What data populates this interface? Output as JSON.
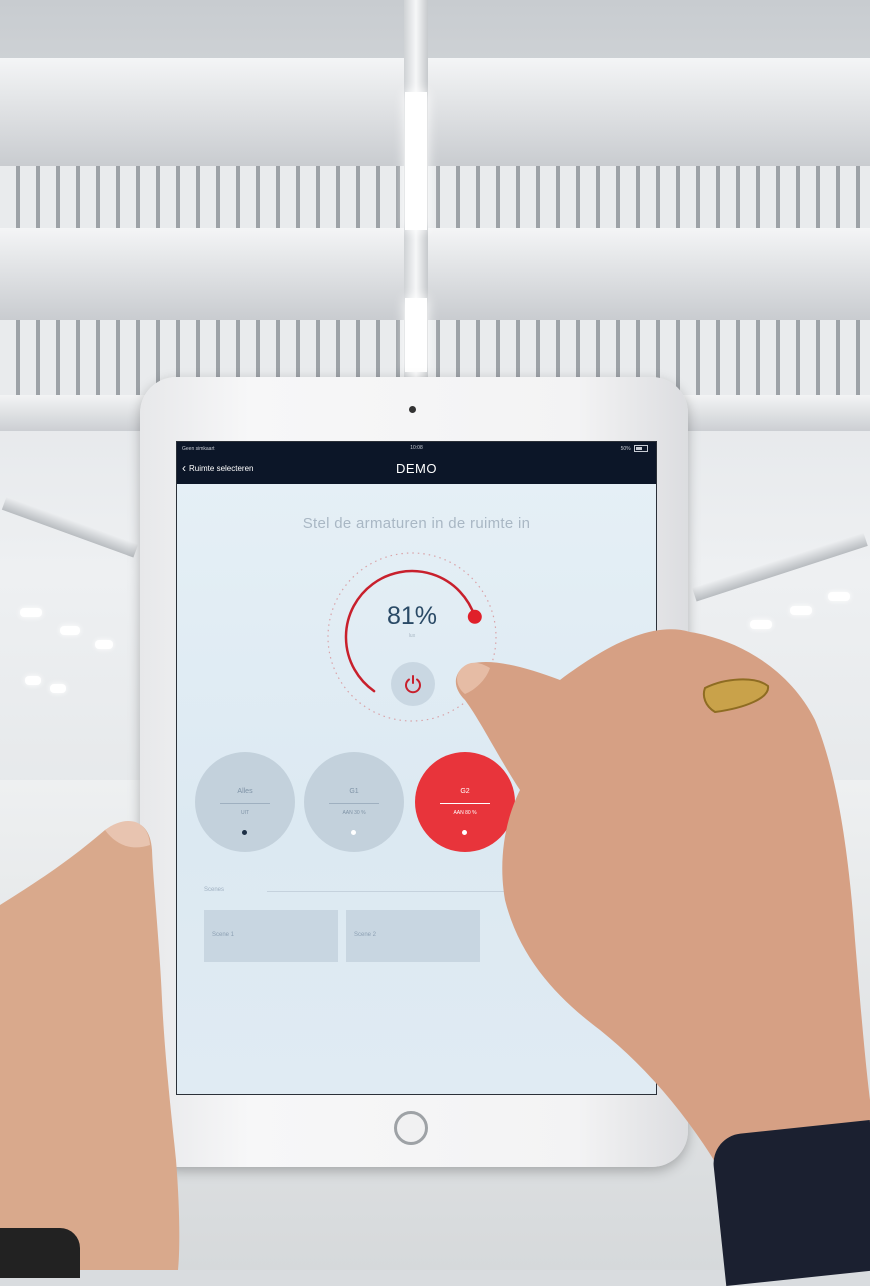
{
  "status_bar": {
    "carrier": "Geen simkaart",
    "time": "10:08",
    "battery": "50%"
  },
  "nav": {
    "back_label": "Ruimte selecteren",
    "title": "DEMO"
  },
  "heading": "Stel de armaturen in de ruimte in",
  "dimmer": {
    "level_label": "81%",
    "level_fraction": 0.81,
    "sub_label": "lux",
    "accent_color": "#c8202c"
  },
  "groups": [
    {
      "name": "Alles",
      "status": "UIT",
      "active": false
    },
    {
      "name": "G1",
      "status": "AAN 30 %",
      "active": false
    },
    {
      "name": "G2",
      "status": "AAN 80 %",
      "active": true
    }
  ],
  "scenes": {
    "label": "Scenes",
    "items": [
      "Scene 1",
      "Scene 2"
    ]
  },
  "colors": {
    "nav_bar": "#0c1628",
    "active_group": "#e8343b",
    "inactive_group": "#c3d1dc"
  },
  "icons": [
    "back-chevron-icon",
    "power-icon",
    "battery-icon"
  ]
}
